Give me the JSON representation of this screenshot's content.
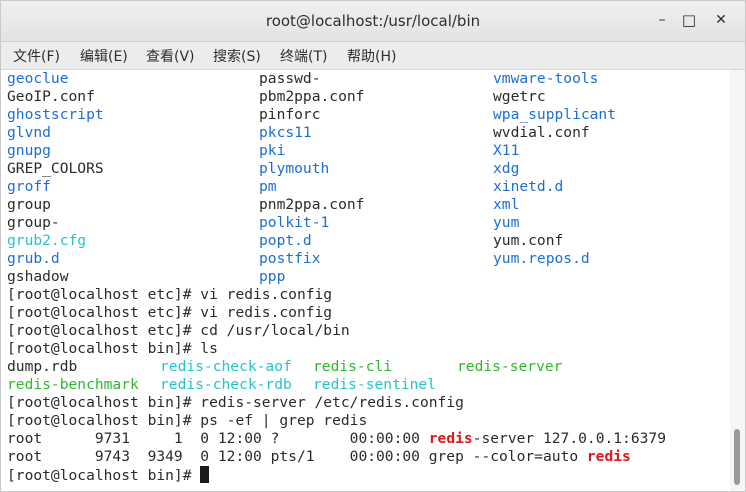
{
  "window": {
    "title": "root@localhost:/usr/local/bin",
    "controls": {
      "minimize": "–",
      "maximize": "□",
      "close": "✕"
    }
  },
  "menu": [
    "文件(F)",
    "编辑(E)",
    "查看(V)",
    "搜索(S)",
    "终端(T)",
    "帮助(H)"
  ],
  "colors": {
    "dir": "#1c6ed6",
    "link": "#24c4cf",
    "exec": "#2fb82f",
    "match": "#e0161d"
  },
  "terminal": {
    "listing": [
      [
        {
          "t": "geoclue",
          "c": "blue"
        },
        {
          "t": "passwd-",
          "c": ""
        },
        {
          "t": "vmware-tools",
          "c": "blue"
        }
      ],
      [
        {
          "t": "GeoIP.conf",
          "c": ""
        },
        {
          "t": "pbm2ppa.conf",
          "c": ""
        },
        {
          "t": "wgetrc",
          "c": ""
        }
      ],
      [
        {
          "t": "ghostscript",
          "c": "blue"
        },
        {
          "t": "pinforc",
          "c": ""
        },
        {
          "t": "wpa_supplicant",
          "c": "blue"
        }
      ],
      [
        {
          "t": "glvnd",
          "c": "blue"
        },
        {
          "t": "pkcs11",
          "c": "blue"
        },
        {
          "t": "wvdial.conf",
          "c": ""
        }
      ],
      [
        {
          "t": "gnupg",
          "c": "blue"
        },
        {
          "t": "pki",
          "c": "blue"
        },
        {
          "t": "X11",
          "c": "blue"
        }
      ],
      [
        {
          "t": "GREP_COLORS",
          "c": ""
        },
        {
          "t": "plymouth",
          "c": "blue"
        },
        {
          "t": "xdg",
          "c": "blue"
        }
      ],
      [
        {
          "t": "groff",
          "c": "blue"
        },
        {
          "t": "pm",
          "c": "blue"
        },
        {
          "t": "xinetd.d",
          "c": "blue"
        }
      ],
      [
        {
          "t": "group",
          "c": ""
        },
        {
          "t": "pnm2ppa.conf",
          "c": ""
        },
        {
          "t": "xml",
          "c": "blue"
        }
      ],
      [
        {
          "t": "group-",
          "c": ""
        },
        {
          "t": "polkit-1",
          "c": "blue"
        },
        {
          "t": "yum",
          "c": "blue"
        }
      ],
      [
        {
          "t": "grub2.cfg",
          "c": "cyan"
        },
        {
          "t": "popt.d",
          "c": "blue"
        },
        {
          "t": "yum.conf",
          "c": ""
        }
      ],
      [
        {
          "t": "grub.d",
          "c": "blue"
        },
        {
          "t": "postfix",
          "c": "blue"
        },
        {
          "t": "yum.repos.d",
          "c": "blue"
        }
      ],
      [
        {
          "t": "gshadow",
          "c": ""
        },
        {
          "t": "ppp",
          "c": "blue"
        },
        {
          "t": "",
          "c": ""
        }
      ]
    ],
    "cmd1": "[root@localhost etc]# vi redis.config",
    "cmd2": "[root@localhost etc]# vi redis.config",
    "cmd3": "[root@localhost etc]# cd /usr/local/bin",
    "cmd4": "[root@localhost bin]# ls",
    "ls_rows": [
      [
        {
          "t": "dump.rdb",
          "c": ""
        },
        {
          "t": "redis-check-aof",
          "c": "cyan"
        },
        {
          "t": "redis-cli",
          "c": "green"
        },
        {
          "t": "redis-server",
          "c": "green"
        }
      ],
      [
        {
          "t": "redis-benchmark",
          "c": "green"
        },
        {
          "t": "redis-check-rdb",
          "c": "cyan"
        },
        {
          "t": "redis-sentinel",
          "c": "cyan"
        },
        {
          "t": "",
          "c": ""
        }
      ]
    ],
    "cmd5": "[root@localhost bin]# redis-server /etc/redis.config",
    "cmd6": "[root@localhost bin]# ps -ef | grep redis",
    "ps1": {
      "prefix": "root      9731     1  0 12:00 ?        00:00:00 ",
      "match": "redis",
      "suffix": "-server 127.0.0.1:6379"
    },
    "ps2": {
      "prefix": "root      9743  9349  0 12:00 pts/1    00:00:00 grep --color=auto ",
      "match": "redis",
      "suffix": ""
    },
    "prompt": "[root@localhost bin]# "
  }
}
